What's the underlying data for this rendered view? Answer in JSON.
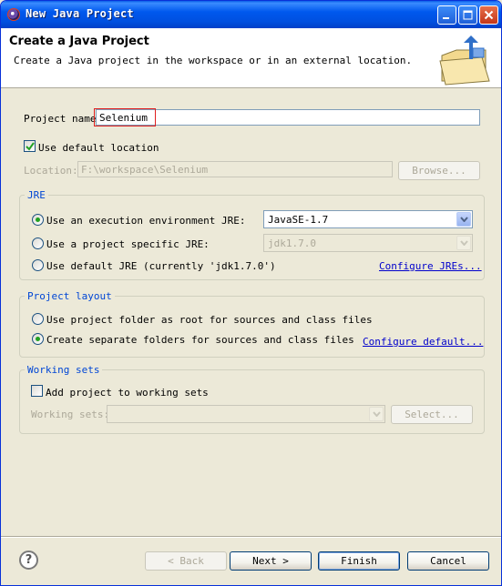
{
  "window": {
    "title": "New Java Project"
  },
  "header": {
    "title": "Create a Java Project",
    "description": "Create a Java project in the workspace or in an external location."
  },
  "project_name": {
    "label": "Project name:",
    "value": "Selenium"
  },
  "default_location": {
    "label": "Use default location",
    "checked": true
  },
  "location": {
    "label": "Location:",
    "value": "F:\\workspace\\Selenium",
    "browse_label": "Browse..."
  },
  "jre": {
    "group_title": "JRE",
    "option_env": "Use an execution environment JRE:",
    "env_value": "JavaSE-1.7",
    "option_specific": "Use a project specific JRE:",
    "specific_value": "jdk1.7.0",
    "option_default": "Use default JRE (currently 'jdk1.7.0')",
    "configure_link": "Configure JREs...",
    "selected": "env"
  },
  "project_layout": {
    "group_title": "Project layout",
    "option_root": "Use project folder as root for sources and class files",
    "option_separate": "Create separate folders for sources and class files",
    "configure_link": "Configure default...",
    "selected": "separate"
  },
  "working_sets": {
    "group_title": "Working sets",
    "add_label": "Add project to working sets",
    "checked": false,
    "sets_label": "Working sets:",
    "select_label": "Select..."
  },
  "buttons": {
    "back": "< Back",
    "next": "Next >",
    "finish": "Finish",
    "cancel": "Cancel"
  },
  "colors": {
    "titlebar": "#0058EE",
    "dialog_bg": "#ECE9D8",
    "group_title": "#0046D5",
    "link": "#0000CC",
    "highlight": "#E02020"
  }
}
